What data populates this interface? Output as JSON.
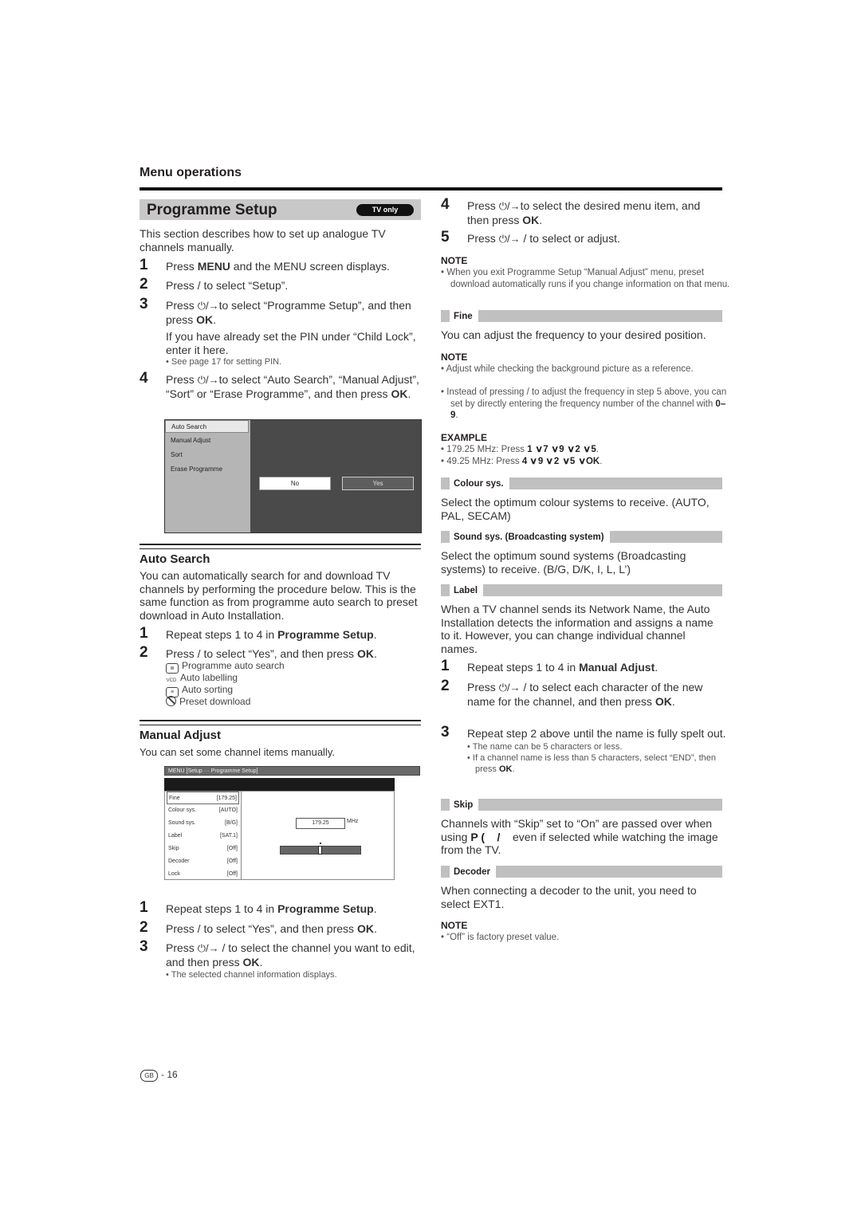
{
  "header": {
    "section": "Menu operations"
  },
  "programme_setup": {
    "title": "Programme Setup",
    "badge": "TV only",
    "intro": "This section describes how to set up analogue TV channels manually.",
    "steps": [
      {
        "num": "1",
        "pre": "Press ",
        "bold": "MENU",
        "post": " and the MENU screen displays."
      },
      {
        "num": "2",
        "text": "Press    /    to select “Setup”."
      },
      {
        "num": "3",
        "pre": "Press ",
        "icons": "⏻/→",
        "mid": "to select “Programme Setup”, and then press ",
        "bold": "OK",
        "post": ".",
        "extra": "If you have already set the PIN under “Child Lock”, enter it here.",
        "sub": "See page 17 for setting PIN."
      },
      {
        "num": "4",
        "pre": "Press ",
        "icons": "⏻/→",
        "mid": "to select “Auto Search”, “Manual Adjust”, “Sort” or “Erase Programme”, and then press ",
        "bold": "OK",
        "post": "."
      }
    ],
    "menu_screen": {
      "items": [
        "Auto Search",
        "Manual Adjust",
        "Sort",
        "Erase Programme"
      ],
      "selected_index": 0,
      "buttons": {
        "no": "No",
        "yes": "Yes"
      }
    }
  },
  "auto_search": {
    "title": "Auto Search",
    "intro": "You can automatically search for and download TV channels  by performing the procedure below. This is the same function as from programme auto search to preset download in Auto Installation.",
    "steps": [
      {
        "num": "1",
        "pre": "Repeat steps 1 to 4 in ",
        "bold": "Programme Setup",
        "post": "."
      },
      {
        "num": "2",
        "pre": "Press    /    to select “Yes”, and then press ",
        "bold": "OK",
        "post": "."
      }
    ],
    "process": [
      {
        "icon": "programme-auto-search-icon",
        "glyph": "≣",
        "label": "Programme auto search"
      },
      {
        "icon": "auto-labelling-icon",
        "glyph": "VCD",
        "label": "Auto labelling"
      },
      {
        "icon": "auto-sorting-icon",
        "glyph": "≡",
        "label": "Auto sorting"
      },
      {
        "icon": "preset-download-icon",
        "glyph": "",
        "label": "Preset download"
      }
    ]
  },
  "manual_adjust": {
    "title": "Manual Adjust",
    "intro": "You can set some channel items manually.",
    "screen": {
      "breadcrumb": "MENU   [Setup ··· Programme Setup]",
      "rows": [
        {
          "key": "Fine",
          "value": "[179.25]"
        },
        {
          "key": "Colour sys.",
          "value": "[AUTO]"
        },
        {
          "key": "Sound sys.",
          "value": "[B/G]"
        },
        {
          "key": "Label",
          "value": "[SAT.1]"
        },
        {
          "key": "Skip",
          "value": "[Off]"
        },
        {
          "key": "Decoder",
          "value": "[Off]"
        },
        {
          "key": "Lock",
          "value": "[Off]"
        }
      ],
      "frequency": "179.25",
      "unit": "MHz",
      "slider_position": 0.5
    },
    "steps": [
      {
        "num": "1",
        "pre": "Repeat steps 1 to 4 in ",
        "bold": "Programme Setup",
        "post": "."
      },
      {
        "num": "2",
        "pre": "Press    /    to select “Yes”, and then press ",
        "bold": "OK",
        "post": "."
      },
      {
        "num": "3",
        "pre": "Press ",
        "icons": "⏻/→",
        "mid": " /    to select the channel you want to edit, and then press ",
        "bold": "OK",
        "post": ".",
        "sub": "The selected channel information displays."
      },
      {
        "num": "4",
        "pre": "Press ",
        "icons": "⏻/→",
        "mid": "to select the desired menu item, and then press ",
        "bold": "OK",
        "post": "."
      },
      {
        "num": "5",
        "pre": "Press ",
        "icons": "⏻/→",
        "mid": " /    to select or adjust."
      }
    ],
    "note": {
      "head": "NOTE",
      "items": [
        "When you exit Programme Setup “Manual Adjust” menu, preset download automatically runs if you change information on that menu."
      ]
    }
  },
  "items": {
    "fine": {
      "label": "Fine",
      "text": "You can adjust the frequency to your desired position.",
      "note_head": "NOTE",
      "notes": [
        "Adjust while checking the background picture as a reference.",
        "Instead of pressing    /    to adjust the frequency in step 5 above, you can set by directly entering the frequency number of the channel with "
      ],
      "notes_bold_tail": "0–9",
      "example_head": "EXAMPLE",
      "examples": [
        {
          "pre": "179.25 MHz: Press ",
          "keys": [
            "1",
            "7",
            "9",
            "2",
            "5"
          ]
        },
        {
          "pre": "49.25 MHz: Press ",
          "keys": [
            "4",
            "9",
            "2",
            "5",
            "OK"
          ]
        }
      ]
    },
    "colour": {
      "label": "Colour sys.",
      "text": "Select the optimum colour systems to receive. (AUTO, PAL, SECAM)"
    },
    "sound": {
      "label": "Sound sys. (Broadcasting system)",
      "text": "Select the optimum sound systems (Broadcasting systems) to receive. (B/G, D/K, I, L, L’)"
    },
    "label": {
      "label": "Label",
      "text": "When a TV channel sends its Network Name, the Auto Installation detects the information and assigns a name to it. However, you can change individual channel names.",
      "steps": [
        {
          "num": "1",
          "pre": "Repeat steps 1 to 4 in ",
          "bold": "Manual Adjust",
          "post": "."
        },
        {
          "num": "2",
          "pre": "Press ",
          "icons": "⏻/→",
          "mid": " /    to select each character of the new name for the channel, and then press ",
          "bold": "OK",
          "post": "."
        },
        {
          "num": "3",
          "text": "Repeat step 2 above until the name is fully spelt out."
        }
      ],
      "subs": [
        {
          "text": "The name can be 5 characters or less."
        },
        {
          "pre": "If a channel name is less than 5 characters, select “END”, then press ",
          "bold": "OK",
          "post": "."
        }
      ]
    },
    "skip": {
      "label": "Skip",
      "pre": "Channels with “Skip” set to “On” are passed over when using ",
      "bold": "P (    /    ",
      "post": "even if selected while watching the image from the TV."
    },
    "decoder": {
      "label": "Decoder",
      "text": "When connecting a decoder to the unit, you need to select EXT1.",
      "note_head": "NOTE",
      "note": "“Off” is factory preset value."
    }
  },
  "footer": {
    "region": "GB",
    "page": "- 16"
  }
}
